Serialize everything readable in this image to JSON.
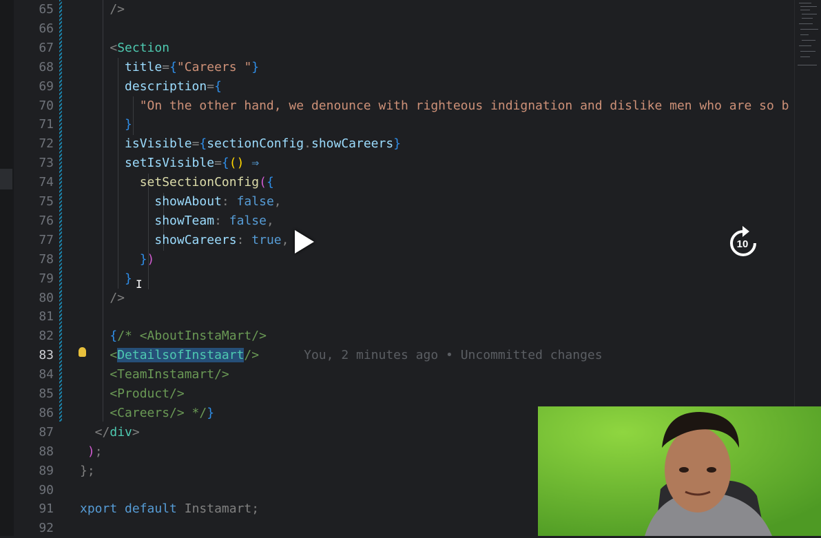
{
  "editor": {
    "lines": [
      {
        "n": "65",
        "tokens": [
          {
            "t": "    />",
            "c": "pu"
          }
        ]
      },
      {
        "n": "66",
        "tokens": []
      },
      {
        "n": "67",
        "tokens": [
          {
            "t": "    <",
            "c": "pu"
          },
          {
            "t": "Section",
            "c": "tg"
          }
        ]
      },
      {
        "n": "68",
        "tokens": [
          {
            "t": "      title",
            "c": "at"
          },
          {
            "t": "=",
            "c": "pu"
          },
          {
            "t": "{",
            "c": "br"
          },
          {
            "t": "\"Careers \"",
            "c": "st"
          },
          {
            "t": "}",
            "c": "br"
          }
        ]
      },
      {
        "n": "69",
        "tokens": [
          {
            "t": "      description",
            "c": "at"
          },
          {
            "t": "=",
            "c": "pu"
          },
          {
            "t": "{",
            "c": "br"
          }
        ]
      },
      {
        "n": "70",
        "tokens": [
          {
            "t": "        \"On the other hand, we denounce with righteous indignation and dislike men who are so b",
            "c": "st"
          }
        ]
      },
      {
        "n": "71",
        "tokens": [
          {
            "t": "      }",
            "c": "br"
          }
        ]
      },
      {
        "n": "72",
        "tokens": [
          {
            "t": "      isVisible",
            "c": "at"
          },
          {
            "t": "=",
            "c": "pu"
          },
          {
            "t": "{",
            "c": "br"
          },
          {
            "t": "sectionConfig",
            "c": "vr"
          },
          {
            "t": ".",
            "c": "pu"
          },
          {
            "t": "showCareers",
            "c": "vr"
          },
          {
            "t": "}",
            "c": "br"
          }
        ]
      },
      {
        "n": "73",
        "tokens": [
          {
            "t": "      setIsVisible",
            "c": "at"
          },
          {
            "t": "=",
            "c": "pu"
          },
          {
            "t": "{",
            "c": "br"
          },
          {
            "t": "()",
            "c": "yb"
          },
          {
            "t": " ⇒",
            "c": "kw"
          }
        ]
      },
      {
        "n": "74",
        "tokens": [
          {
            "t": "        setSectionConfig",
            "c": "fn"
          },
          {
            "t": "(",
            "c": "pk"
          },
          {
            "t": "{",
            "c": "br"
          }
        ]
      },
      {
        "n": "75",
        "tokens": [
          {
            "t": "          showAbout",
            "c": "vr"
          },
          {
            "t": ": ",
            "c": "pu"
          },
          {
            "t": "false",
            "c": "kw"
          },
          {
            "t": ",",
            "c": "pu"
          }
        ]
      },
      {
        "n": "76",
        "tokens": [
          {
            "t": "          showTeam",
            "c": "vr"
          },
          {
            "t": ": ",
            "c": "pu"
          },
          {
            "t": "false",
            "c": "kw"
          },
          {
            "t": ",",
            "c": "pu"
          }
        ]
      },
      {
        "n": "77",
        "tokens": [
          {
            "t": "          showCareers",
            "c": "vr"
          },
          {
            "t": ": ",
            "c": "pu"
          },
          {
            "t": "true",
            "c": "kw"
          },
          {
            "t": ",",
            "c": "pu"
          }
        ]
      },
      {
        "n": "78",
        "tokens": [
          {
            "t": "        }",
            "c": "br"
          },
          {
            "t": ")",
            "c": "pk"
          }
        ]
      },
      {
        "n": "79",
        "tokens": [
          {
            "t": "      }",
            "c": "br"
          }
        ]
      },
      {
        "n": "80",
        "tokens": [
          {
            "t": "    />",
            "c": "pu"
          }
        ]
      },
      {
        "n": "81",
        "tokens": []
      },
      {
        "n": "82",
        "tokens": [
          {
            "t": "    {",
            "c": "br"
          },
          {
            "t": "/* <AboutInstaMart/>",
            "c": "cm"
          }
        ]
      },
      {
        "n": "83",
        "active": true,
        "tokens": [
          {
            "t": "    <",
            "c": "cm"
          },
          {
            "t": "DetailsofInstaart",
            "c": "sel"
          },
          {
            "t": "/>",
            "c": "cm"
          },
          {
            "t": "      You, 2 minutes ago • Uncommitted changes",
            "c": "ghost"
          }
        ]
      },
      {
        "n": "84",
        "tokens": [
          {
            "t": "    <TeamInstamart/>",
            "c": "cm"
          }
        ]
      },
      {
        "n": "85",
        "tokens": [
          {
            "t": "    <Product/>",
            "c": "cm"
          }
        ]
      },
      {
        "n": "86",
        "tokens": [
          {
            "t": "    <Careers/> */",
            "c": "cm"
          },
          {
            "t": "}",
            "c": "br"
          }
        ]
      },
      {
        "n": "87",
        "tokens": [
          {
            "t": "  </",
            "c": "pu"
          },
          {
            "t": "div",
            "c": "tg"
          },
          {
            "t": ">",
            "c": "pu"
          }
        ]
      },
      {
        "n": "88",
        "tokens": [
          {
            "t": " )",
            "c": "pk"
          },
          {
            "t": ";",
            "c": "pu"
          }
        ]
      },
      {
        "n": "89",
        "tokens": [
          {
            "t": "};",
            "c": "pu"
          }
        ]
      },
      {
        "n": "90",
        "tokens": []
      },
      {
        "n": "91",
        "tokens": [
          {
            "t": "xport",
            "c": "kw"
          },
          {
            "t": " ",
            "c": "pu"
          },
          {
            "t": "default",
            "c": "kw"
          },
          {
            "t": " Instamart;",
            "c": "pu"
          }
        ]
      },
      {
        "n": "92",
        "tokens": []
      }
    ]
  },
  "overlay": {
    "replay_seconds": "10",
    "icons": [
      "play-icon",
      "replay-10-icon",
      "text-cursor-icon",
      "lightbulb-icon"
    ]
  },
  "colors": {
    "background": "#1e1f22",
    "selection": "#264f78",
    "webcam_green": "#6bb82f"
  }
}
